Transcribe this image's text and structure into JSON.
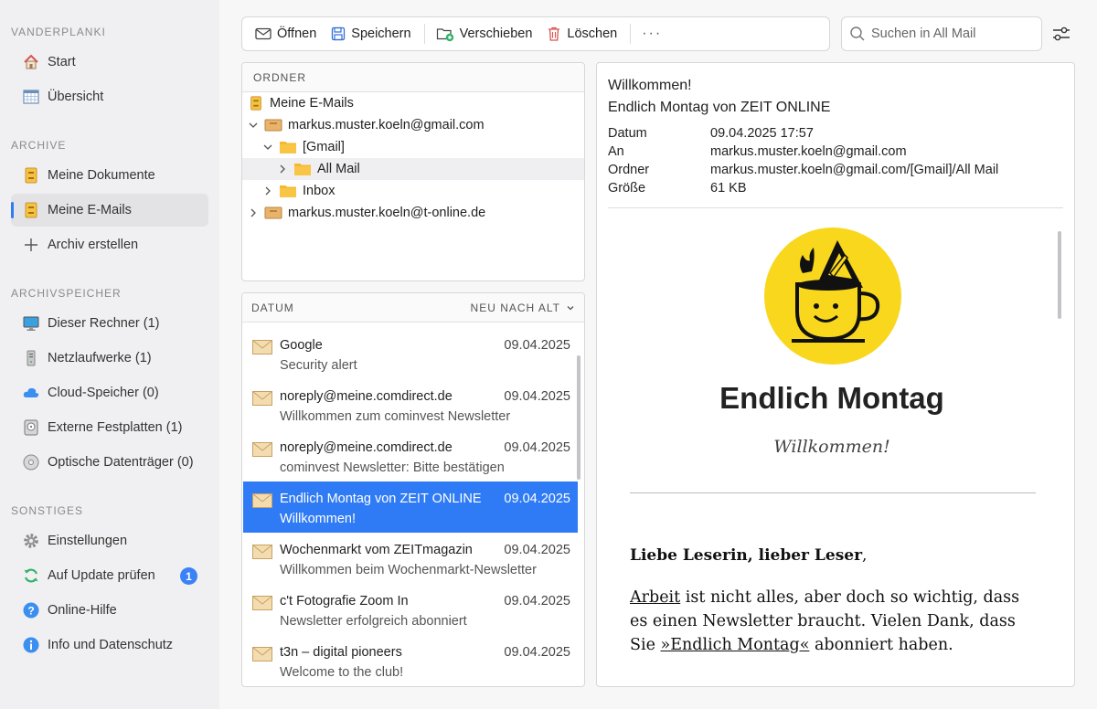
{
  "sidebar": {
    "sections": [
      {
        "title": "VANDERPLANKI"
      },
      {
        "title": "ARCHIVE"
      },
      {
        "title": "ARCHIVSPEICHER"
      },
      {
        "title": "SONSTIGES"
      }
    ],
    "items": [
      {
        "label": "Start",
        "icon": "home-icon"
      },
      {
        "label": "Übersicht",
        "icon": "calendar-grid-icon"
      },
      {
        "label": "Meine Dokumente",
        "icon": "archive-box-icon"
      },
      {
        "label": "Meine E-Mails",
        "icon": "archive-box-icon",
        "active": true
      },
      {
        "label": "Archiv erstellen",
        "icon": "plus-icon"
      },
      {
        "label": "Dieser Rechner (1)",
        "icon": "monitor-icon"
      },
      {
        "label": "Netzlaufwerke (1)",
        "icon": "network-drive-icon"
      },
      {
        "label": "Cloud-Speicher (0)",
        "icon": "cloud-icon"
      },
      {
        "label": "Externe Festplatten (1)",
        "icon": "hard-disk-icon"
      },
      {
        "label": "Optische Datenträger (0)",
        "icon": "optical-disc-icon"
      },
      {
        "label": "Einstellungen",
        "icon": "gear-icon"
      },
      {
        "label": "Auf Update prüfen",
        "icon": "refresh-icon",
        "badge": "1"
      },
      {
        "label": "Online-Hilfe",
        "icon": "help-icon"
      },
      {
        "label": "Info und Datenschutz",
        "icon": "info-icon"
      }
    ]
  },
  "toolbar": {
    "open": "Öffnen",
    "save": "Speichern",
    "move": "Verschieben",
    "delete": "Löschen",
    "more": "···"
  },
  "search": {
    "placeholder": "Suchen in All Mail"
  },
  "folders": {
    "header": "ORDNER",
    "rows": [
      {
        "label": "Meine E-Mails"
      },
      {
        "label": "markus.muster.koeln@gmail.com"
      },
      {
        "label": "[Gmail]"
      },
      {
        "label": "All Mail",
        "selected": true
      },
      {
        "label": "Inbox"
      },
      {
        "label": "markus.muster.koeln@t-online.de"
      }
    ]
  },
  "list": {
    "header": "DATUM",
    "sort": "NEU NACH ALT",
    "mails": [
      {
        "from": "Google",
        "date": "09.04.2025",
        "subject": "Security alert"
      },
      {
        "from": "noreply@meine.comdirect.de",
        "date": "09.04.2025",
        "subject": "Willkommen zum cominvest Newsletter"
      },
      {
        "from": "noreply@meine.comdirect.de",
        "date": "09.04.2025",
        "subject": "cominvest Newsletter: Bitte bestätigen"
      },
      {
        "from": "Endlich Montag von ZEIT ONLINE",
        "date": "09.04.2025",
        "subject": "Willkommen!",
        "selected": true
      },
      {
        "from": "Wochenmarkt vom ZEITmagazin",
        "date": "09.04.2025",
        "subject": "Willkommen beim Wochenmarkt-Newsletter"
      },
      {
        "from": "c't Fotografie Zoom In",
        "date": "09.04.2025",
        "subject": "Newsletter erfolgreich abonniert"
      },
      {
        "from": "t3n – digital pioneers",
        "date": "09.04.2025",
        "subject": "Welcome to the club!"
      }
    ]
  },
  "preview": {
    "title": "Willkommen!",
    "subtitle": "Endlich Montag von ZEIT ONLINE",
    "meta": [
      {
        "key": "Datum",
        "value": "09.04.2025 17:57"
      },
      {
        "key": "An",
        "value": "markus.muster.koeln@gmail.com"
      },
      {
        "key": "Ordner",
        "value": "markus.muster.koeln@gmail.com/[Gmail]/All Mail"
      },
      {
        "key": "Größe",
        "value": "61 KB"
      }
    ],
    "newsletter": {
      "title": "Endlich Montag",
      "welcome": "Willkommen!",
      "greeting": "Liebe Leserin, lieber Leser",
      "greeting_punct": ",",
      "link1": "Arbeit",
      "text1": " ist nicht alles, aber doch so wichtig, dass es einen Newsletter braucht. Vielen Dank, dass Sie ",
      "link2": "»Endlich Montag«",
      "text2": " abonniert haben."
    }
  },
  "colors": {
    "accent": "#2f7bf5",
    "badge": "#3b82f6",
    "logo_yellow": "#f8d71c"
  }
}
